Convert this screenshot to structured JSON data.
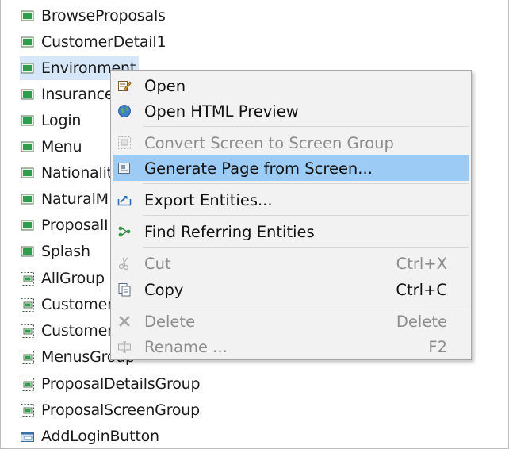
{
  "tree": {
    "items": [
      {
        "label": "BrowseProposals",
        "icon": "screen-icon"
      },
      {
        "label": "CustomerDetail1",
        "icon": "screen-icon"
      },
      {
        "label": "Environment",
        "icon": "screen-icon",
        "selected": true
      },
      {
        "label": "Insurance",
        "icon": "screen-icon"
      },
      {
        "label": "Login",
        "icon": "screen-icon"
      },
      {
        "label": "Menu",
        "icon": "screen-icon"
      },
      {
        "label": "Nationalit",
        "icon": "screen-icon"
      },
      {
        "label": "NaturalM",
        "icon": "screen-icon"
      },
      {
        "label": "ProposalI",
        "icon": "screen-icon"
      },
      {
        "label": "Splash",
        "icon": "screen-icon"
      },
      {
        "label": "AllGroup",
        "icon": "screen-group-icon"
      },
      {
        "label": "Customer",
        "icon": "screen-group-icon"
      },
      {
        "label": "Customer",
        "icon": "screen-group-icon"
      },
      {
        "label": "MenusGroup",
        "icon": "screen-group-icon"
      },
      {
        "label": "ProposalDetailsGroup",
        "icon": "screen-group-icon"
      },
      {
        "label": "ProposalScreenGroup",
        "icon": "screen-group-icon"
      },
      {
        "label": "AddLoginButton",
        "icon": "button-component-icon"
      }
    ]
  },
  "context_menu": {
    "items": [
      {
        "label": "Open",
        "shortcut": "",
        "icon": "open-edit-icon",
        "enabled": true
      },
      {
        "label": "Open HTML Preview",
        "shortcut": "",
        "icon": "globe-icon",
        "enabled": true
      },
      {
        "label": "Convert Screen to Screen Group",
        "shortcut": "",
        "icon": "convert-screen-icon",
        "enabled": false
      },
      {
        "label": "Generate Page from Screen...",
        "shortcut": "",
        "icon": "generate-page-icon",
        "enabled": true,
        "highlighted": true
      },
      {
        "label": "Export Entities...",
        "shortcut": "",
        "icon": "export-icon",
        "enabled": true
      },
      {
        "label": "Find Referring Entities",
        "shortcut": "",
        "icon": "find-references-icon",
        "enabled": true
      },
      {
        "label": "Cut",
        "shortcut": "Ctrl+X",
        "icon": "scissors-icon",
        "enabled": false
      },
      {
        "label": "Copy",
        "shortcut": "Ctrl+C",
        "icon": "copy-icon",
        "enabled": true
      },
      {
        "label": "Delete",
        "shortcut": "Delete",
        "icon": "delete-x-icon",
        "enabled": false
      },
      {
        "label": "Rename ...",
        "shortcut": "F2",
        "icon": "rename-icon",
        "enabled": false
      }
    ]
  },
  "colors": {
    "selection": "#d5e7f8",
    "menu_highlight": "#9ccbf6",
    "menu_background": "#f2f2f2",
    "screen_icon_green": "#2e9e4e",
    "disabled_text": "#8d8d8d"
  }
}
